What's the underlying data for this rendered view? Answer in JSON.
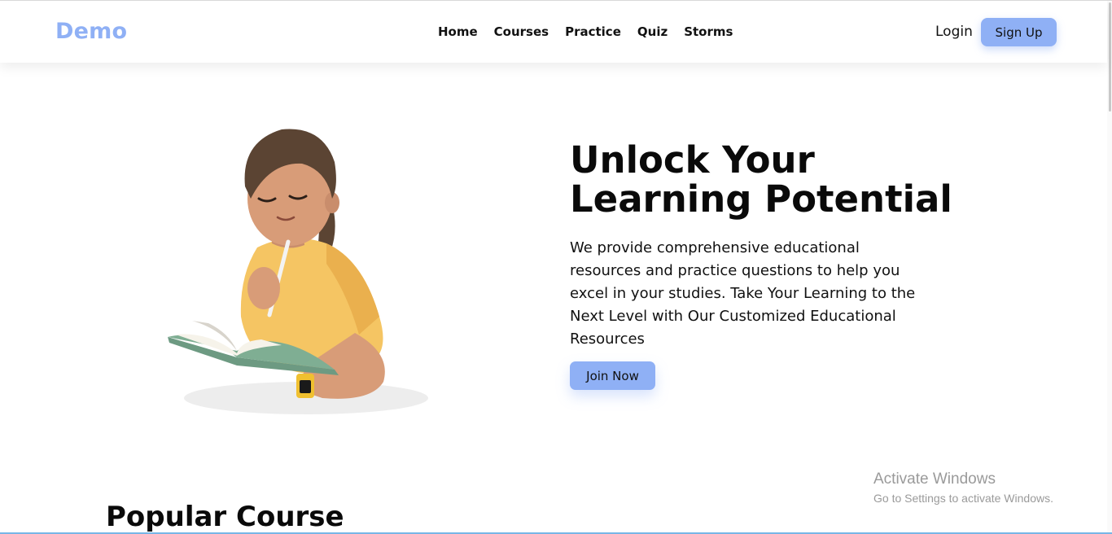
{
  "header": {
    "logo": "Demo",
    "nav": [
      "Home",
      "Courses",
      "Practice",
      "Quiz",
      "Storms"
    ],
    "login_label": "Login",
    "signup_label": "Sign Up"
  },
  "hero": {
    "title_line1": "Unlock Your",
    "title_line2": "Learning Potential",
    "description": "We provide comprehensive educational resources and practice questions to help you excel in your studies. Take Your Learning to the Next Level with Our Customized Educational Resources",
    "join_label": "Join Now"
  },
  "sections": {
    "popular_title": "Popular Course"
  },
  "watermark": {
    "title": "Activate Windows",
    "subtitle": "Go to Settings to activate Windows."
  },
  "colors": {
    "accent": "#8fb0f5",
    "text": "#0a0a0a",
    "shirt": "#f5c563",
    "book": "#7fae93"
  }
}
